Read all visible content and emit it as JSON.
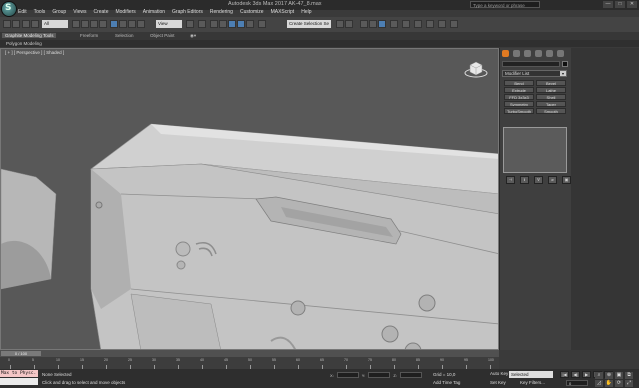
{
  "window": {
    "logo_letter": "S",
    "title": "Autodesk 3ds Max 2017   AK-47_8.max",
    "search_placeholder": "Type a keyword or phrase",
    "controls": [
      "—",
      "□",
      "✕"
    ]
  },
  "menu": [
    "Edit",
    "Tools",
    "Group",
    "Views",
    "Create",
    "Modifiers",
    "Animation",
    "Graph Editors",
    "Rendering",
    "Customize",
    "MAXScript",
    "Help"
  ],
  "toolbar": {
    "filter_value": "All",
    "view_value": "View",
    "selection_set_placeholder": "Create Selection Se"
  },
  "ribbon": {
    "tabs": [
      "Graphite Modeling Tools",
      "Freeform",
      "Selection",
      "Object Paint"
    ],
    "active_tab": "Graphite Modeling Tools",
    "sub_label": "Polygon Modeling"
  },
  "viewport": {
    "label": "[ + ] [ Perspective ] [ Shaded ]"
  },
  "command_panel": {
    "modifier_list_label": "Modifier List",
    "buttons": [
      "Bend",
      "Bevel",
      "Extrude",
      "Lathe",
      "FFD 3x3x3",
      "Shell",
      "Symmetry",
      "Taper",
      "TurboSmooth",
      "Smooth"
    ],
    "stack_buttons": [
      "⊣",
      "‖",
      "∀",
      "⌀",
      "▣"
    ]
  },
  "timeline": {
    "slider_label": "0 / 100",
    "ticks": [
      "0",
      "5",
      "10",
      "15",
      "20",
      "25",
      "30",
      "35",
      "40",
      "45",
      "50",
      "55",
      "60",
      "65",
      "70",
      "75",
      "80",
      "85",
      "90",
      "95",
      "100"
    ]
  },
  "status": {
    "maxscript_text": "Max to Physc.",
    "selection": "None Selected",
    "prompt": "Click and drag to select and move objects",
    "coord_labels": [
      "X:",
      "Y:",
      "Z:"
    ],
    "grid": "Grid = 10,0",
    "add_time_tag": "Add Time Tag",
    "auto_key": "Auto Key",
    "set_key": "Set Key",
    "selected_option": "Selected",
    "key_filters": "Key Filters...",
    "frame": "0",
    "playback": [
      "|◀",
      "◀|",
      "▶",
      "|▶",
      "▶|"
    ],
    "nav_icons": [
      "search-icon",
      "zoom-all-icon",
      "zoom-extents-icon",
      "zoom-extents-all-icon",
      "fov-icon",
      "pan-icon",
      "orbit-icon",
      "maximize-icon"
    ]
  },
  "colors": {
    "accent": "#e07a22",
    "active_tool": "#4d7fb3",
    "viewport_bg": "#585858",
    "model": "#c2c2c2"
  }
}
